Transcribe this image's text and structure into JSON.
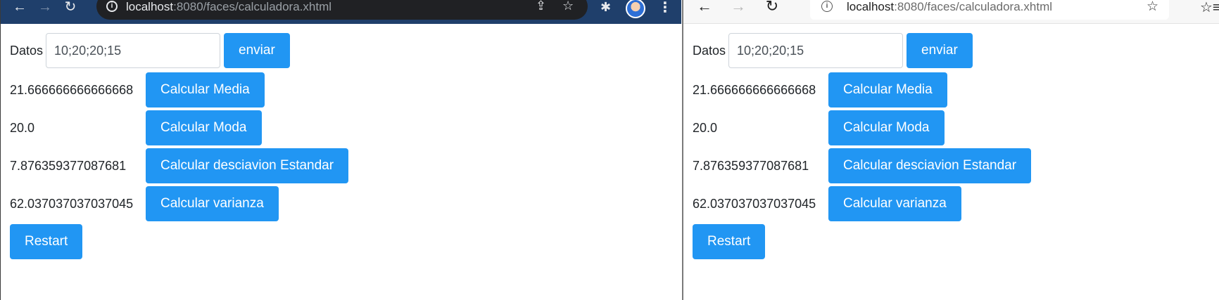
{
  "browser": {
    "url_host": "localhost",
    "url_rest": ":8080/faces/calculadora.xhtml",
    "back_glyph": "←",
    "forward_glyph": "→",
    "reload_glyph": "↻",
    "info_glyph": "i",
    "share_glyph": "⇪",
    "star_glyph": "☆",
    "extensions_glyph": "✱",
    "menu_glyph": "⋮",
    "favorites_glyph": "☆≡",
    "left_theme_color": "#1f3f6b",
    "right_theme_color": "#f7f7f7"
  },
  "form": {
    "datos_label": "Datos",
    "datos_value": "10;20;20;15",
    "enviar_label": "enviar"
  },
  "results": [
    {
      "value": "21.666666666666668",
      "button": "Calcular Media"
    },
    {
      "value": "20.0",
      "button": "Calcular Moda"
    },
    {
      "value": "7.876359377087681",
      "button": "Calcular desciavion Estandar"
    },
    {
      "value": "62.037037037037045",
      "button": "Calcular varianza"
    }
  ],
  "restart_label": "Restart",
  "colors": {
    "button_bg": "#2196f3",
    "button_text": "#ffffff",
    "text": "#212529"
  }
}
